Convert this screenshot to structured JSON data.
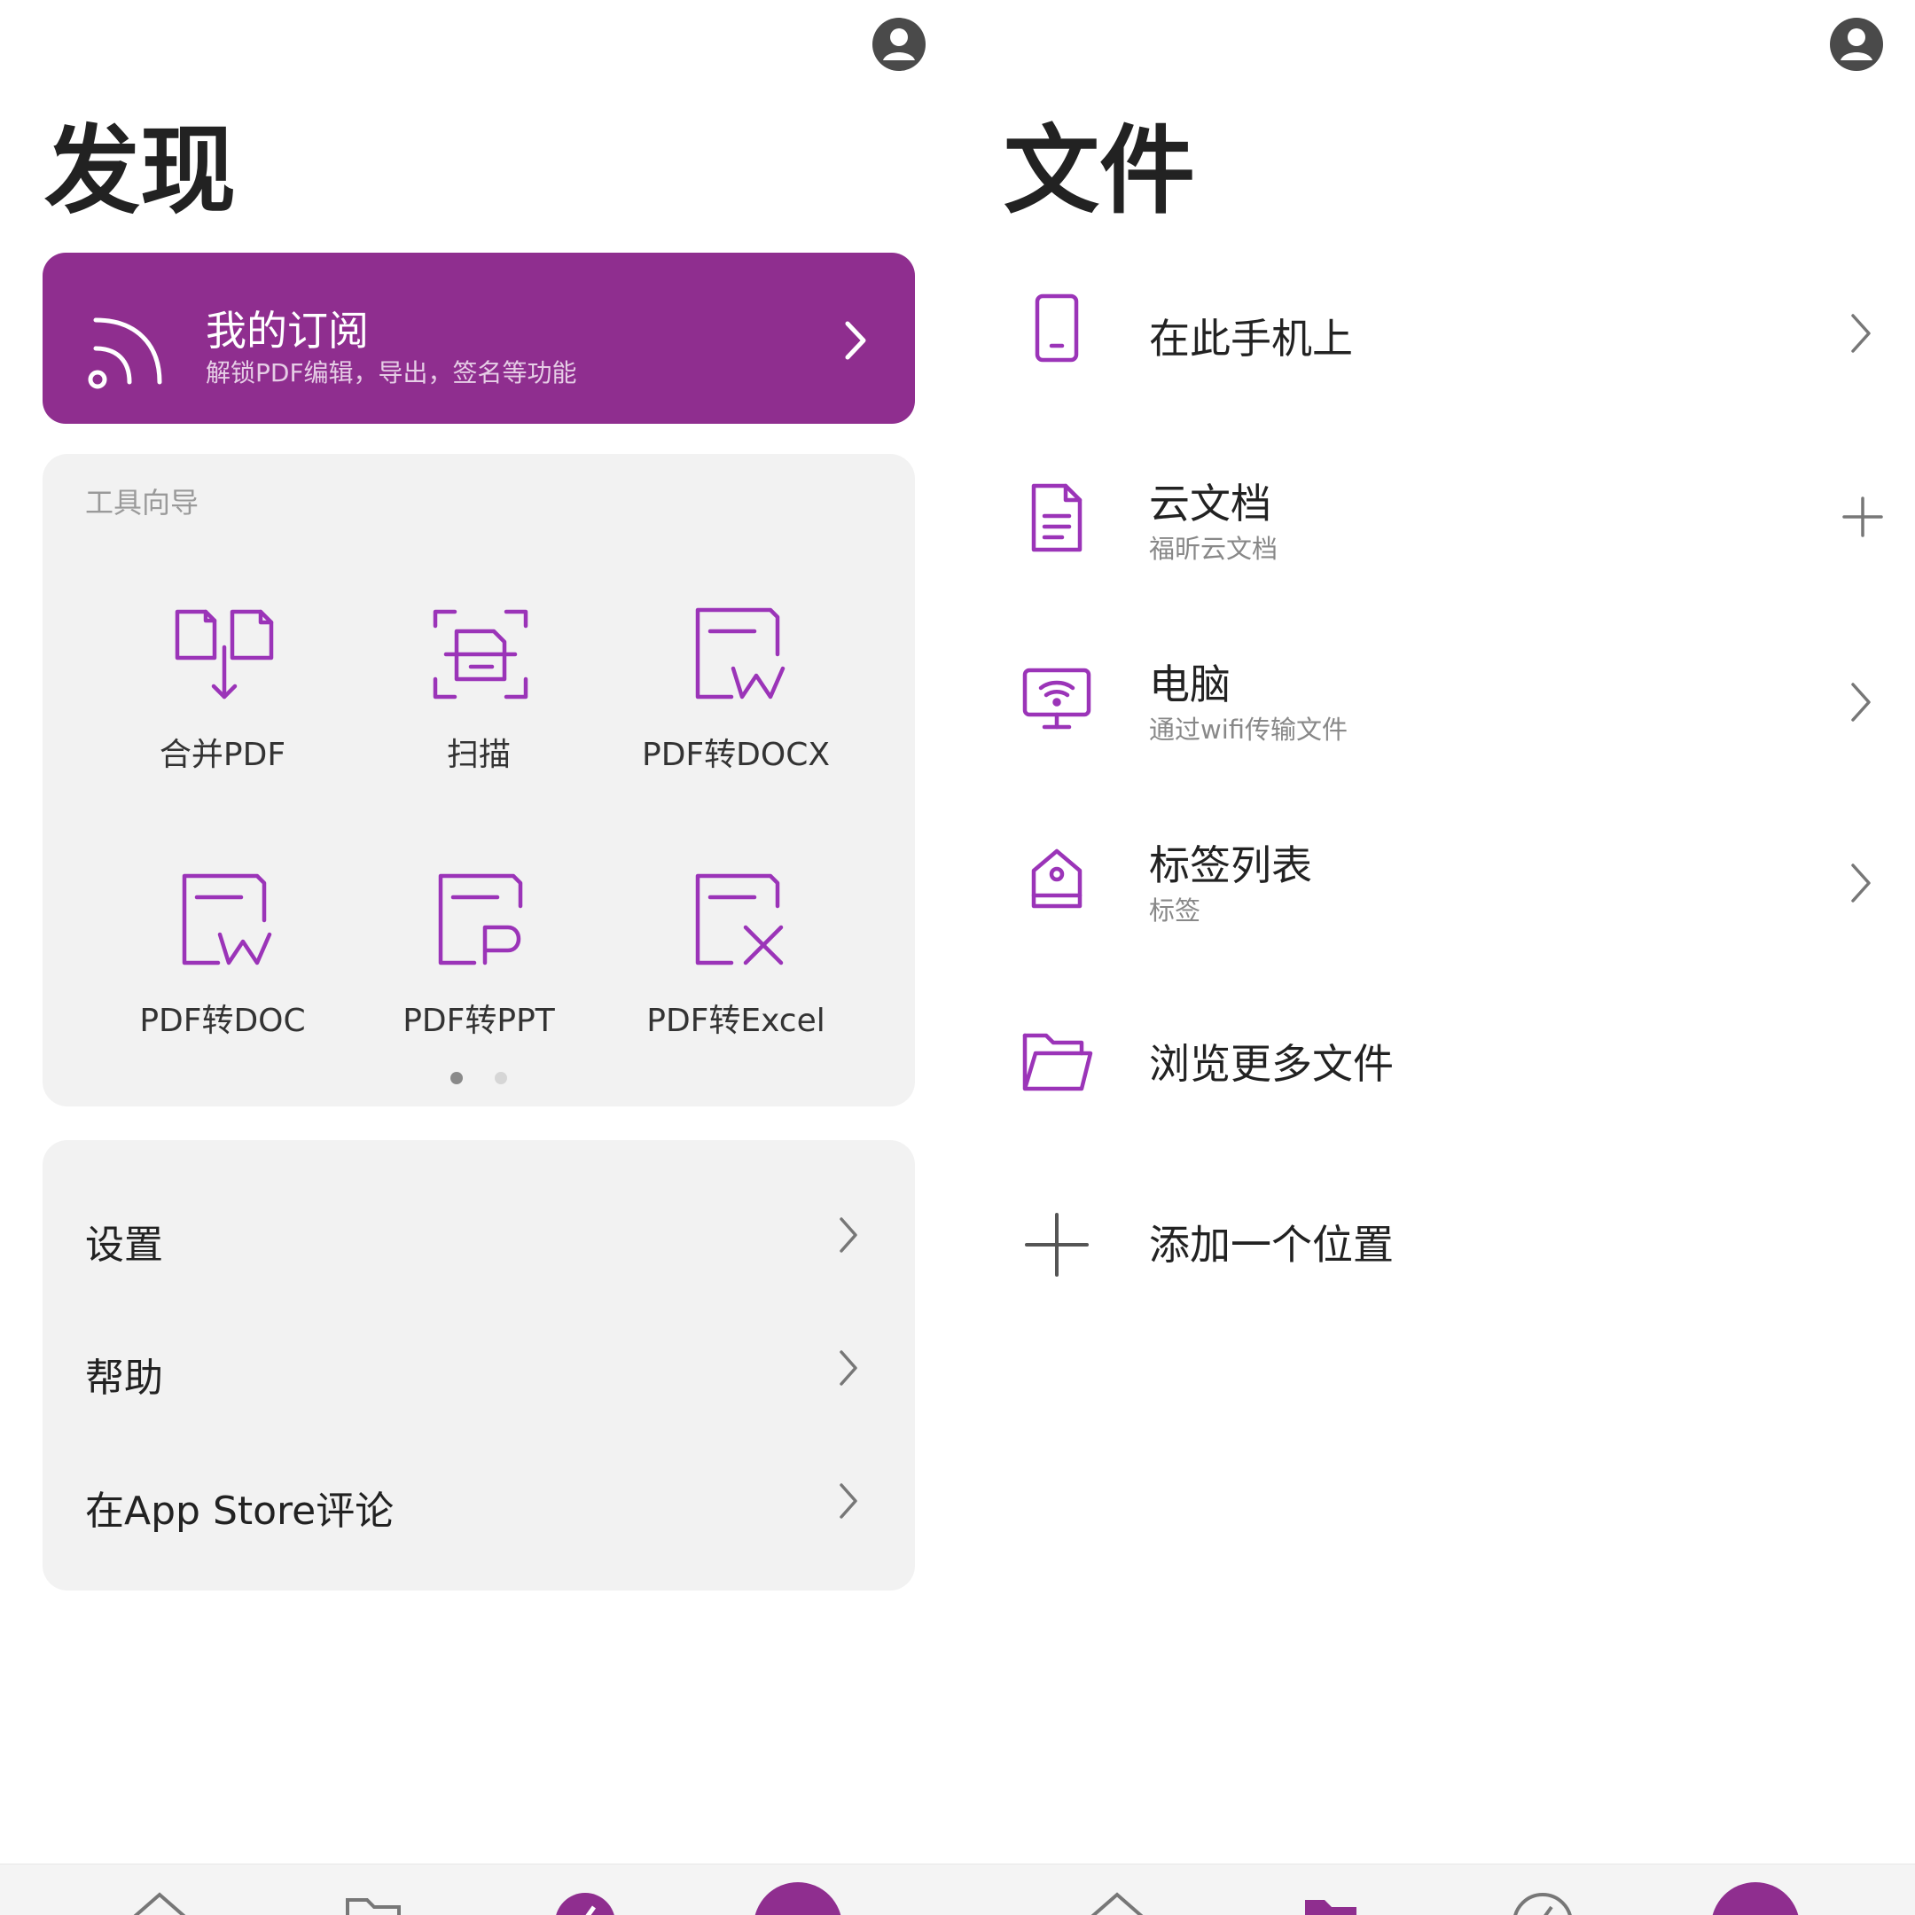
{
  "discover": {
    "title": "发现",
    "subscription": {
      "title": "我的订阅",
      "desc": "解锁PDF编辑，导出，签名等功能"
    },
    "tools": {
      "section_label": "工具向导",
      "items": [
        {
          "label": "合并PDF",
          "icon": "merge-pdf-icon"
        },
        {
          "label": "扫描",
          "icon": "scan-icon"
        },
        {
          "label": "PDF转DOCX",
          "icon": "pdf-to-docx-icon"
        },
        {
          "label": "PDF转DOC",
          "icon": "pdf-to-doc-icon"
        },
        {
          "label": "PDF转PPT",
          "icon": "pdf-to-ppt-icon"
        },
        {
          "label": "PDF转Excel",
          "icon": "pdf-to-excel-icon"
        }
      ],
      "page_count": 2,
      "active_page": 1
    },
    "settings": [
      {
        "label": "设置"
      },
      {
        "label": "帮助"
      },
      {
        "label": "在App Store评论"
      }
    ]
  },
  "files": {
    "title": "文件",
    "locations": [
      {
        "title": "在此手机上",
        "subtitle": "",
        "icon": "phone-icon",
        "trailing": "chevron"
      },
      {
        "title": "云文档",
        "subtitle": "福昕云文档",
        "icon": "document-icon",
        "trailing": "plus"
      },
      {
        "title": "电脑",
        "subtitle": "通过wifi传输文件",
        "icon": "wifi-monitor-icon",
        "trailing": "chevron"
      },
      {
        "title": "标签列表",
        "subtitle": "标签",
        "icon": "tag-icon",
        "trailing": "chevron"
      },
      {
        "title": "浏览更多文件",
        "subtitle": "",
        "icon": "folder-icon",
        "trailing": ""
      },
      {
        "title": "添加一个位置",
        "subtitle": "",
        "icon": "add-icon",
        "trailing": ""
      }
    ]
  },
  "colors": {
    "accent": "#8f2e8f",
    "card_bg": "#f2f2f2",
    "text": "#222222",
    "muted": "#888888"
  }
}
